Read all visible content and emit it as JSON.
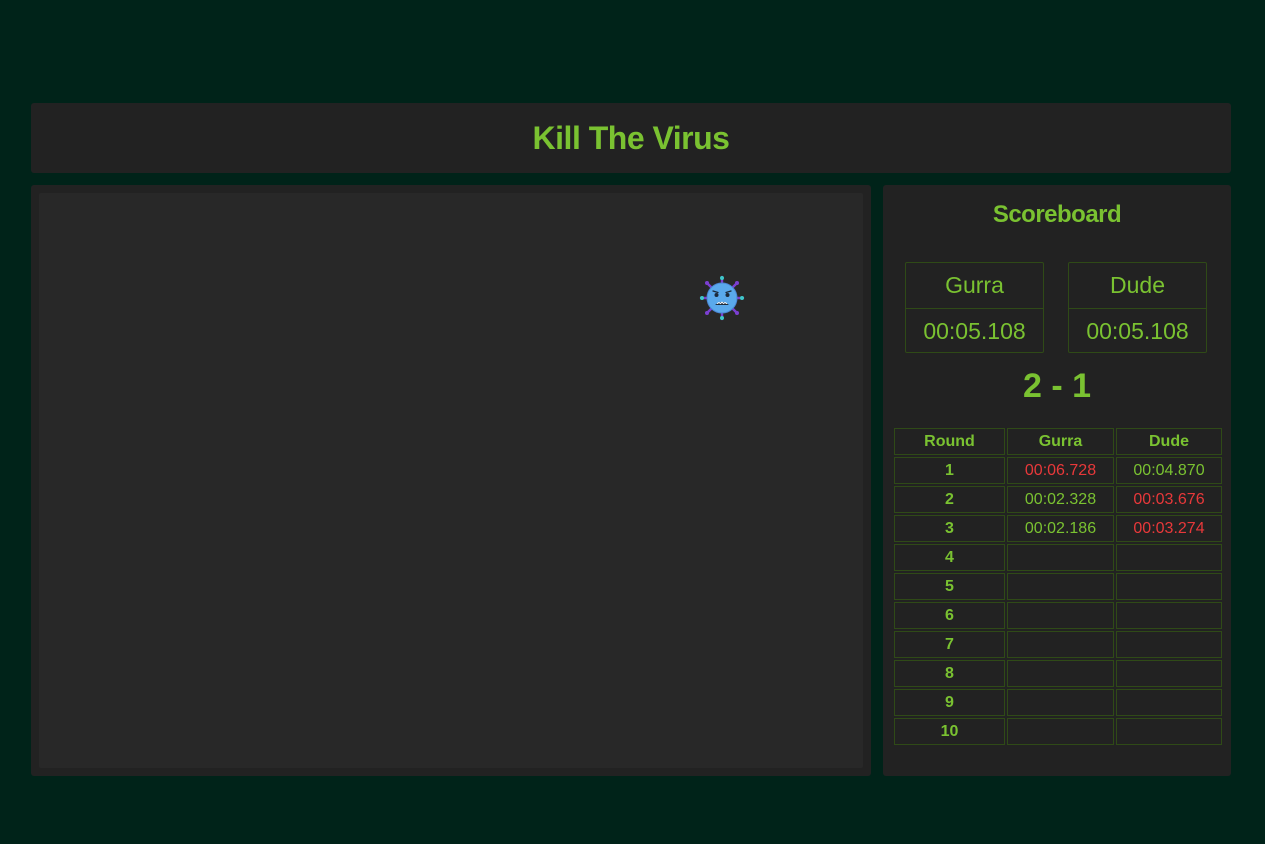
{
  "header": {
    "title": "Kill The Virus"
  },
  "game": {
    "virus_icon": "virus-face-icon"
  },
  "scoreboard": {
    "title": "Scoreboard",
    "players": [
      {
        "name": "Gurra",
        "time": "00:05.108"
      },
      {
        "name": "Dude",
        "time": "00:05.108"
      }
    ],
    "tally": "2 - 1",
    "table": {
      "headers": [
        "Round",
        "Gurra",
        "Dude"
      ],
      "rows": [
        {
          "round": "1",
          "gurra": "00:06.728",
          "dude": "00:04.870",
          "loser": "gurra"
        },
        {
          "round": "2",
          "gurra": "00:02.328",
          "dude": "00:03.676",
          "loser": "dude"
        },
        {
          "round": "3",
          "gurra": "00:02.186",
          "dude": "00:03.274",
          "loser": "dude"
        },
        {
          "round": "4",
          "gurra": "",
          "dude": "",
          "loser": ""
        },
        {
          "round": "5",
          "gurra": "",
          "dude": "",
          "loser": ""
        },
        {
          "round": "6",
          "gurra": "",
          "dude": "",
          "loser": ""
        },
        {
          "round": "7",
          "gurra": "",
          "dude": "",
          "loser": ""
        },
        {
          "round": "8",
          "gurra": "",
          "dude": "",
          "loser": ""
        },
        {
          "round": "9",
          "gurra": "",
          "dude": "",
          "loser": ""
        },
        {
          "round": "10",
          "gurra": "",
          "dude": "",
          "loser": ""
        }
      ]
    }
  },
  "colors": {
    "background": "#002319",
    "panel": "#222222",
    "accent": "#7ac231",
    "loser": "#e8383a"
  }
}
